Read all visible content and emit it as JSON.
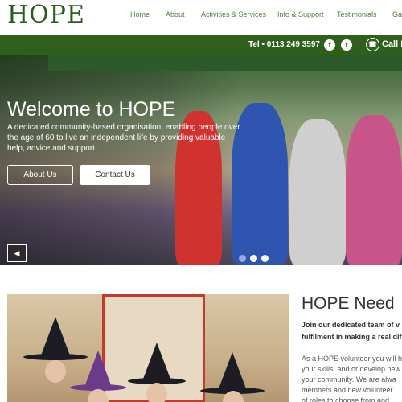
{
  "header": {
    "logo_text": "HOPE",
    "nav": [
      {
        "label": "Home"
      },
      {
        "label": "About"
      },
      {
        "label": "Activities & Services"
      },
      {
        "label": "Info & Support"
      },
      {
        "label": "Testimonials"
      },
      {
        "label": "Gal"
      }
    ]
  },
  "topbar": {
    "tel": "Tel • 0113 249 3597",
    "social": [
      "facebook-icon",
      "twitter-icon"
    ],
    "call_label": "Call B"
  },
  "hero": {
    "title": "Welcome to HOPE",
    "text": "A dedicated community-based organisation, enabling people over the age of 60 to live an independent life by providing valuable help, advice and support.",
    "about_button": "About Us",
    "contact_button": "Contact Us",
    "prev_arrow": "◀",
    "slides": 3,
    "active_slide": 2
  },
  "section": {
    "title": "HOPE Need",
    "bold_lines": [
      "Join our dedicated team of v",
      "fulfilment in making a real dif"
    ],
    "body_lines": [
      "As a HOPE volunteer you will h",
      "your skills, and or develop new",
      "your community. We are alwa",
      "members and new volunteer",
      "of roles to choose from and i"
    ]
  },
  "colors": {
    "brand_green": "#2f5f1d",
    "nav_green": "#4f7b3a"
  }
}
